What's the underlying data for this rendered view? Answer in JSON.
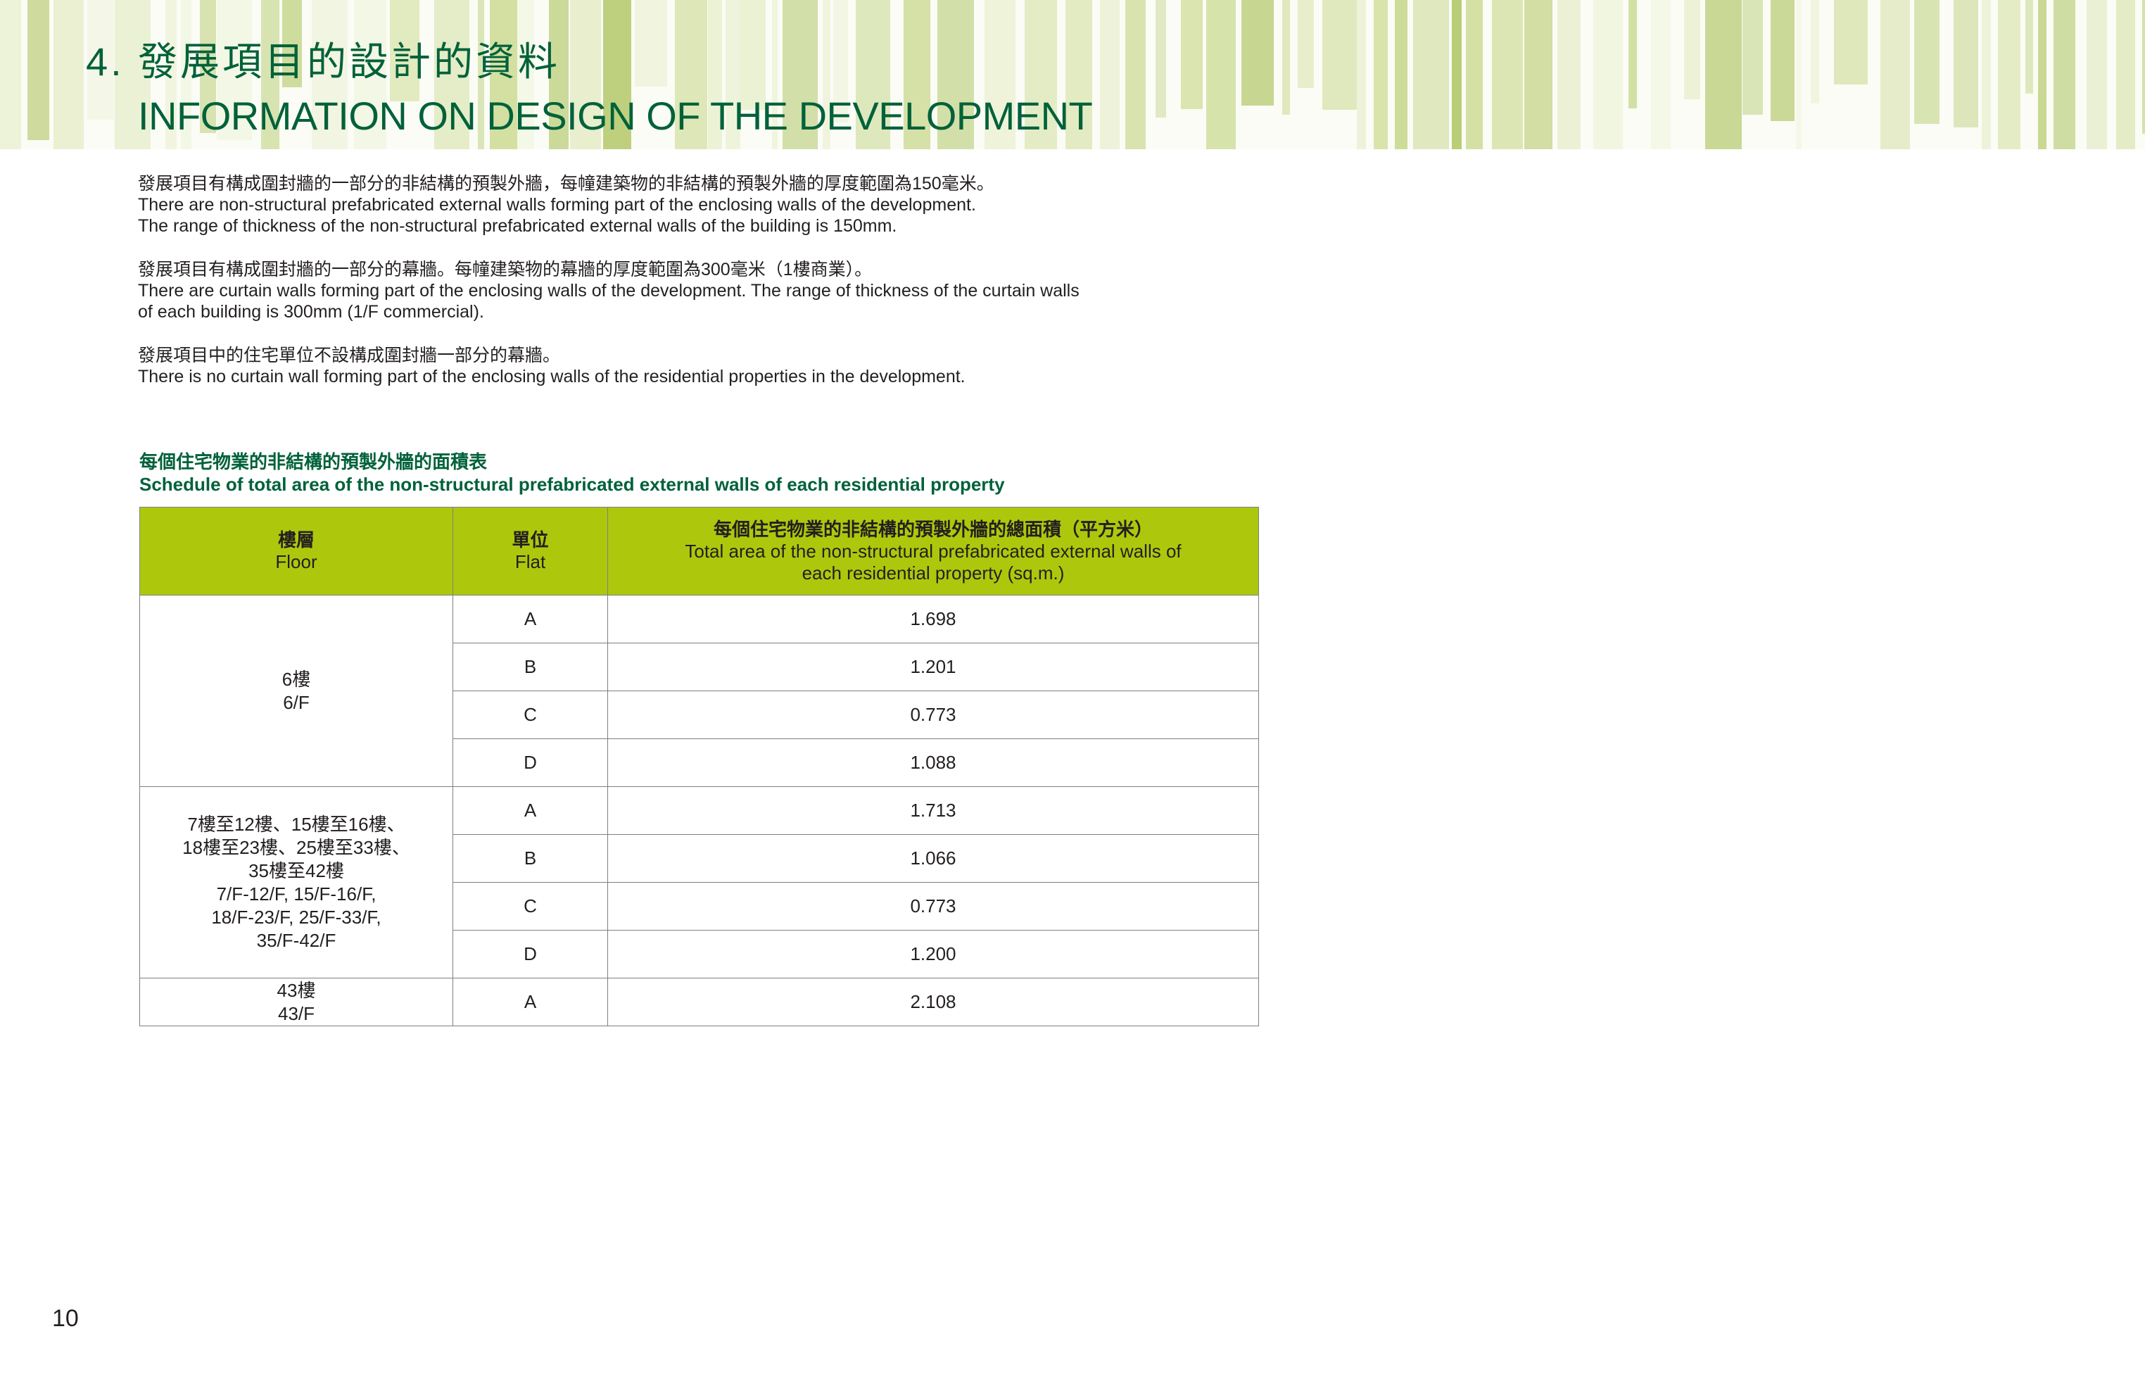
{
  "section": {
    "number": "4.",
    "title_zh": "發展項目的設計的資料",
    "title_en": "INFORMATION ON DESIGN OF THE DEVELOPMENT"
  },
  "paragraphs": [
    {
      "zh": "發展項目有構成圍封牆的一部分的非結構的預製外牆，每幢建築物的非結構的預製外牆的厚度範圍為150毫米。",
      "en_lines": [
        "There are non-structural prefabricated external walls forming part of the enclosing walls of the development.",
        "The range of thickness of the non-structural prefabricated external walls of the building is 150mm."
      ]
    },
    {
      "zh": "發展項目有構成圍封牆的一部分的幕牆。每幢建築物的幕牆的厚度範圍為300毫米（1樓商業）。",
      "en_lines": [
        "There are curtain walls forming part of the enclosing walls of the development. The range of thickness of the curtain walls",
        "of each building is 300mm (1/F commercial)."
      ]
    },
    {
      "zh": "發展項目中的住宅單位不設構成圍封牆一部分的幕牆。",
      "en_lines": [
        "There is no curtain wall forming part of the enclosing walls of the residential properties in the development."
      ]
    }
  ],
  "schedule": {
    "title_zh": "每個住宅物業的非結構的預製外牆的面積表",
    "title_en": "Schedule of total area of the non-structural prefabricated external walls of each residential property",
    "headers": {
      "floor_zh": "樓層",
      "floor_en": "Floor",
      "flat_zh": "單位",
      "flat_en": "Flat",
      "area_zh": "每個住宅物業的非結構的預製外牆的總面積（平方米）",
      "area_en_line1": "Total area of the non-structural prefabricated external walls of",
      "area_en_line2": "each residential property (sq.m.)"
    },
    "groups": [
      {
        "floor_lines": [
          "6樓",
          "6/F"
        ],
        "rows": [
          {
            "flat": "A",
            "area": "1.698"
          },
          {
            "flat": "B",
            "area": "1.201"
          },
          {
            "flat": "C",
            "area": "0.773"
          },
          {
            "flat": "D",
            "area": "1.088"
          }
        ]
      },
      {
        "floor_lines": [
          "7樓至12樓、15樓至16樓、",
          "18樓至23樓、25樓至33樓、",
          "35樓至42樓",
          "7/F-12/F, 15/F-16/F,",
          "18/F-23/F, 25/F-33/F,",
          "35/F-42/F"
        ],
        "rows": [
          {
            "flat": "A",
            "area": "1.713"
          },
          {
            "flat": "B",
            "area": "1.066"
          },
          {
            "flat": "C",
            "area": "0.773"
          },
          {
            "flat": "D",
            "area": "1.200"
          }
        ]
      },
      {
        "floor_lines": [
          "43樓",
          "43/F"
        ],
        "rows": [
          {
            "flat": "A",
            "area": "2.108"
          }
        ]
      }
    ]
  },
  "page_number": "10",
  "colors": {
    "heading_green": "#00613a",
    "table_header_green": "#adc80c",
    "banner_stripes": [
      "#e4ecc5",
      "#d2dfa0",
      "#c3d48a",
      "#eef3da",
      "#b9cc74",
      "#dfe8bb",
      "#ccdb96"
    ]
  }
}
